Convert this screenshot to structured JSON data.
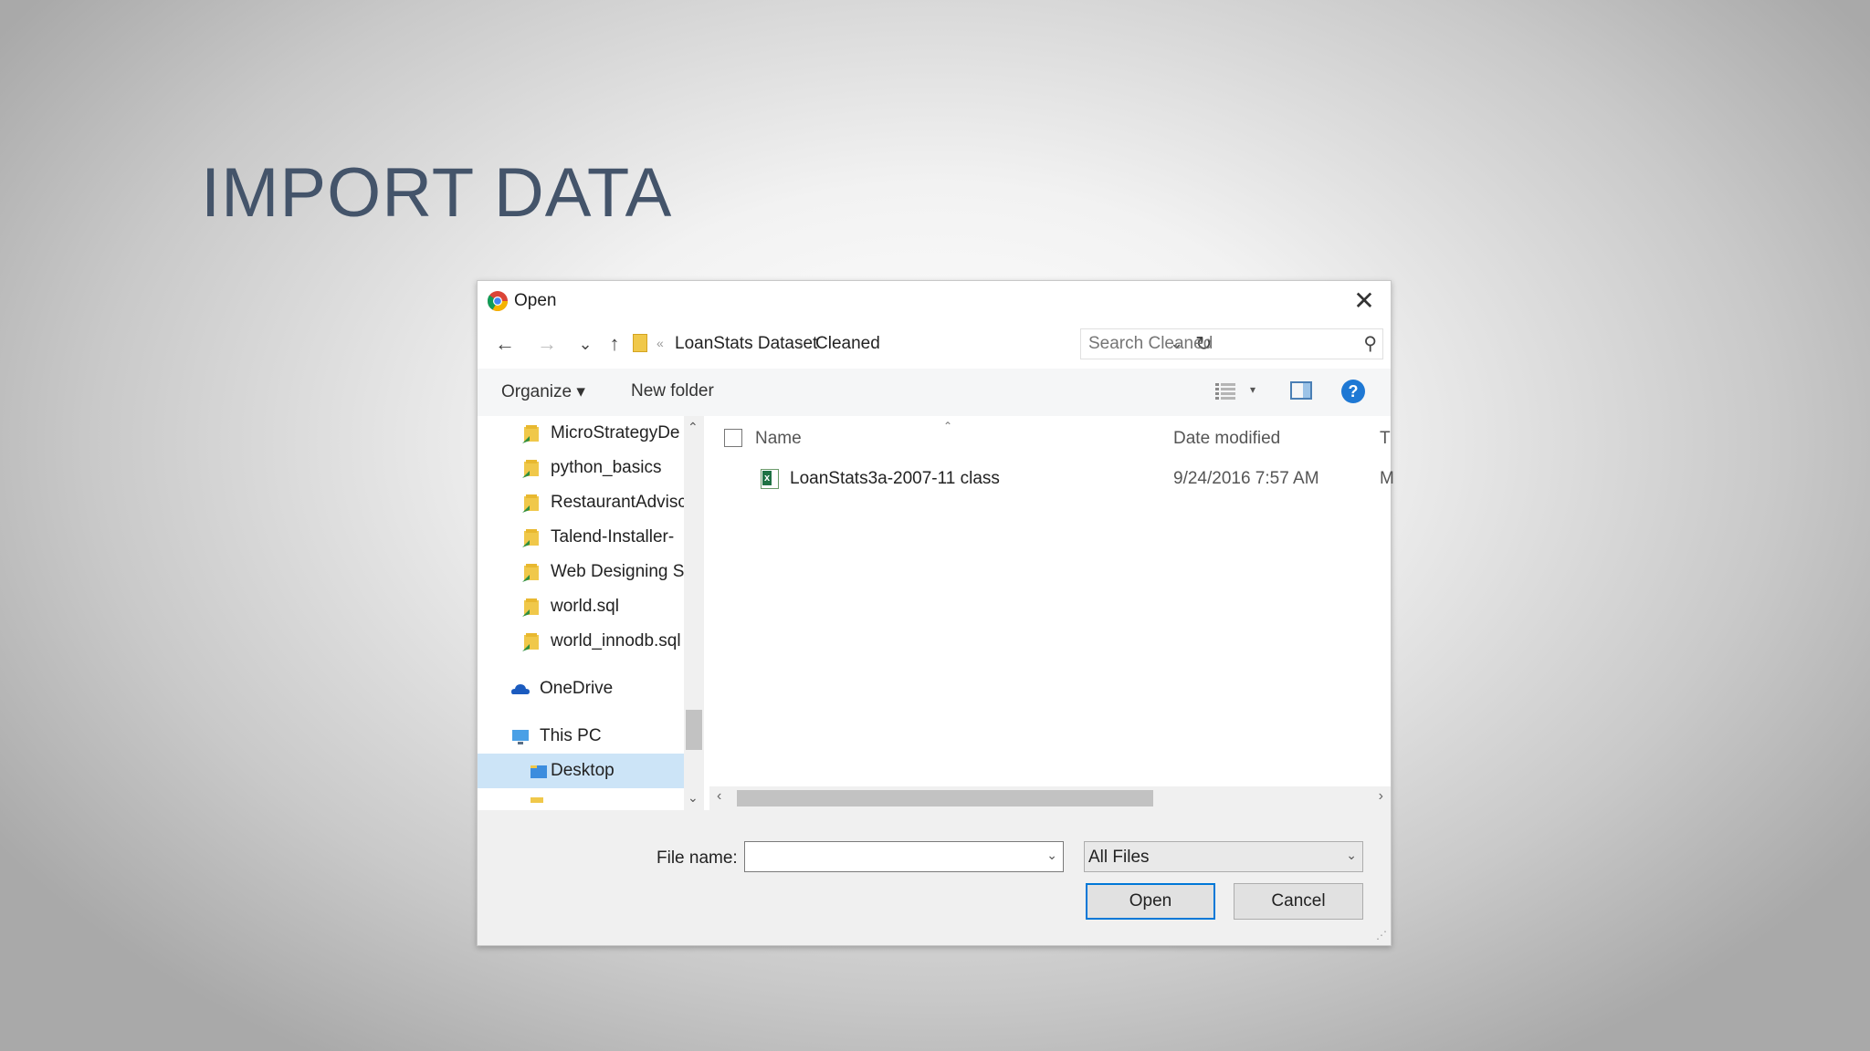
{
  "slide": {
    "title": "IMPORT DATA"
  },
  "dialog": {
    "title": "Open",
    "close_glyph": "✕",
    "nav": {
      "back": "←",
      "forward": "→",
      "recent": "⌄",
      "up": "↑"
    },
    "breadcrumb": [
      "LoanStats Dataset",
      "Cleaned"
    ],
    "breadcrumb_sep": "›",
    "search_placeholder": "Search Cleaned",
    "toolbar": {
      "organize": "Organize ▾",
      "new_folder": "New folder",
      "help": "?"
    },
    "nav_pane": {
      "items": [
        {
          "label": "MicroStrategyDe",
          "icon": "folder-shortcut-icon"
        },
        {
          "label": "python_basics",
          "icon": "folder-shortcut-icon"
        },
        {
          "label": "RestaurantAdvisc",
          "icon": "folder-shortcut-icon"
        },
        {
          "label": "Talend-Installer-",
          "icon": "folder-shortcut-icon"
        },
        {
          "label": "Web Designing S",
          "icon": "folder-shortcut-icon"
        },
        {
          "label": "world.sql",
          "icon": "folder-shortcut-icon"
        },
        {
          "label": "world_innodb.sql",
          "icon": "folder-shortcut-icon"
        },
        {
          "label": "OneDrive",
          "icon": "cloud-icon"
        },
        {
          "label": "This PC",
          "icon": "computer-icon"
        },
        {
          "label": "Desktop",
          "icon": "desktop-folder-icon",
          "selected": true
        }
      ]
    },
    "columns": {
      "name": "Name",
      "date": "Date modified",
      "type": "T"
    },
    "files": [
      {
        "name": "LoanStats3a-2007-11 class",
        "date": "9/24/2016 7:57 AM",
        "type": "M",
        "icon": "excel-file-icon"
      }
    ],
    "file_name_label": "File name:",
    "file_name_value": "",
    "filter": "All Files",
    "buttons": {
      "open": "Open",
      "cancel": "Cancel"
    },
    "colors": {
      "accent": "#0078d7",
      "title": "#44546a",
      "selection": "#cce4f7"
    }
  }
}
